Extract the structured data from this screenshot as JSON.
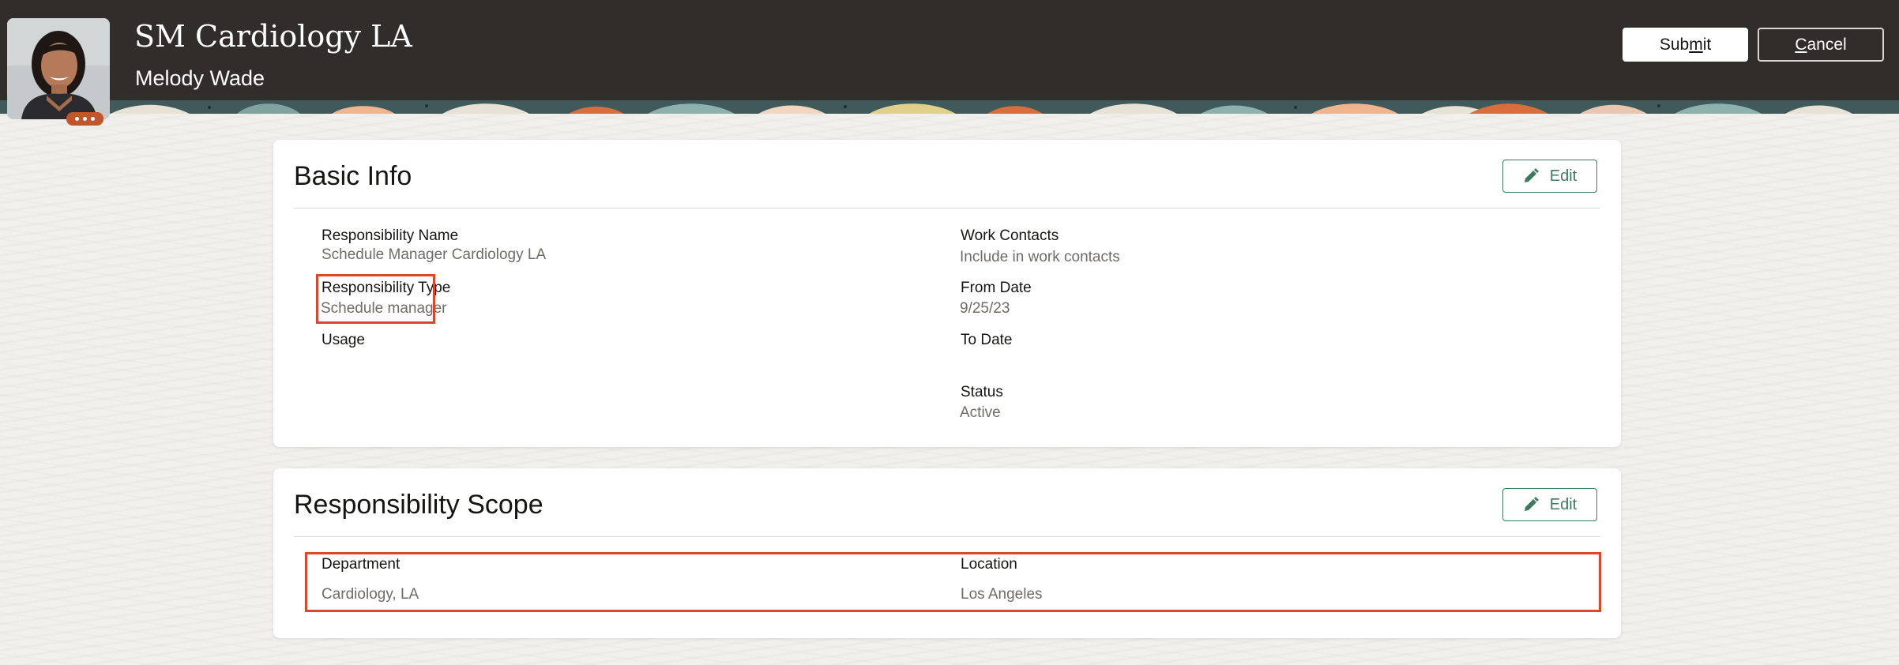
{
  "header": {
    "title": "SM Cardiology LA",
    "subtitle": "Melody Wade",
    "avatar_icon": "person-photo",
    "more_icon": "more-dots-icon"
  },
  "actions": {
    "submit_pre": "Sub",
    "submit_key": "m",
    "submit_post": "it",
    "cancel_key": "C",
    "cancel_post": "ancel"
  },
  "basic_info": {
    "title": "Basic Info",
    "edit_label": "Edit",
    "fields": {
      "responsibility_name": {
        "label": "Responsibility Name",
        "value": "Schedule Manager Cardiology LA"
      },
      "responsibility_type": {
        "label": "Responsibility Type",
        "value": "Schedule manager"
      },
      "usage": {
        "label": "Usage",
        "value": ""
      },
      "work_contacts": {
        "label": "Work Contacts",
        "value": "Include in work contacts"
      },
      "from_date": {
        "label": "From Date",
        "value": "9/25/23"
      },
      "to_date": {
        "label": "To Date",
        "value": ""
      },
      "status": {
        "label": "Status",
        "value": "Active"
      }
    }
  },
  "responsibility_scope": {
    "title": "Responsibility Scope",
    "edit_label": "Edit",
    "fields": {
      "department": {
        "label": "Department",
        "value": "Cardiology, LA"
      },
      "location": {
        "label": "Location",
        "value": "Los Angeles"
      }
    }
  },
  "colors": {
    "header_bg": "#312d2a",
    "accent": "#3d7a5f",
    "highlight": "#e0442b"
  }
}
